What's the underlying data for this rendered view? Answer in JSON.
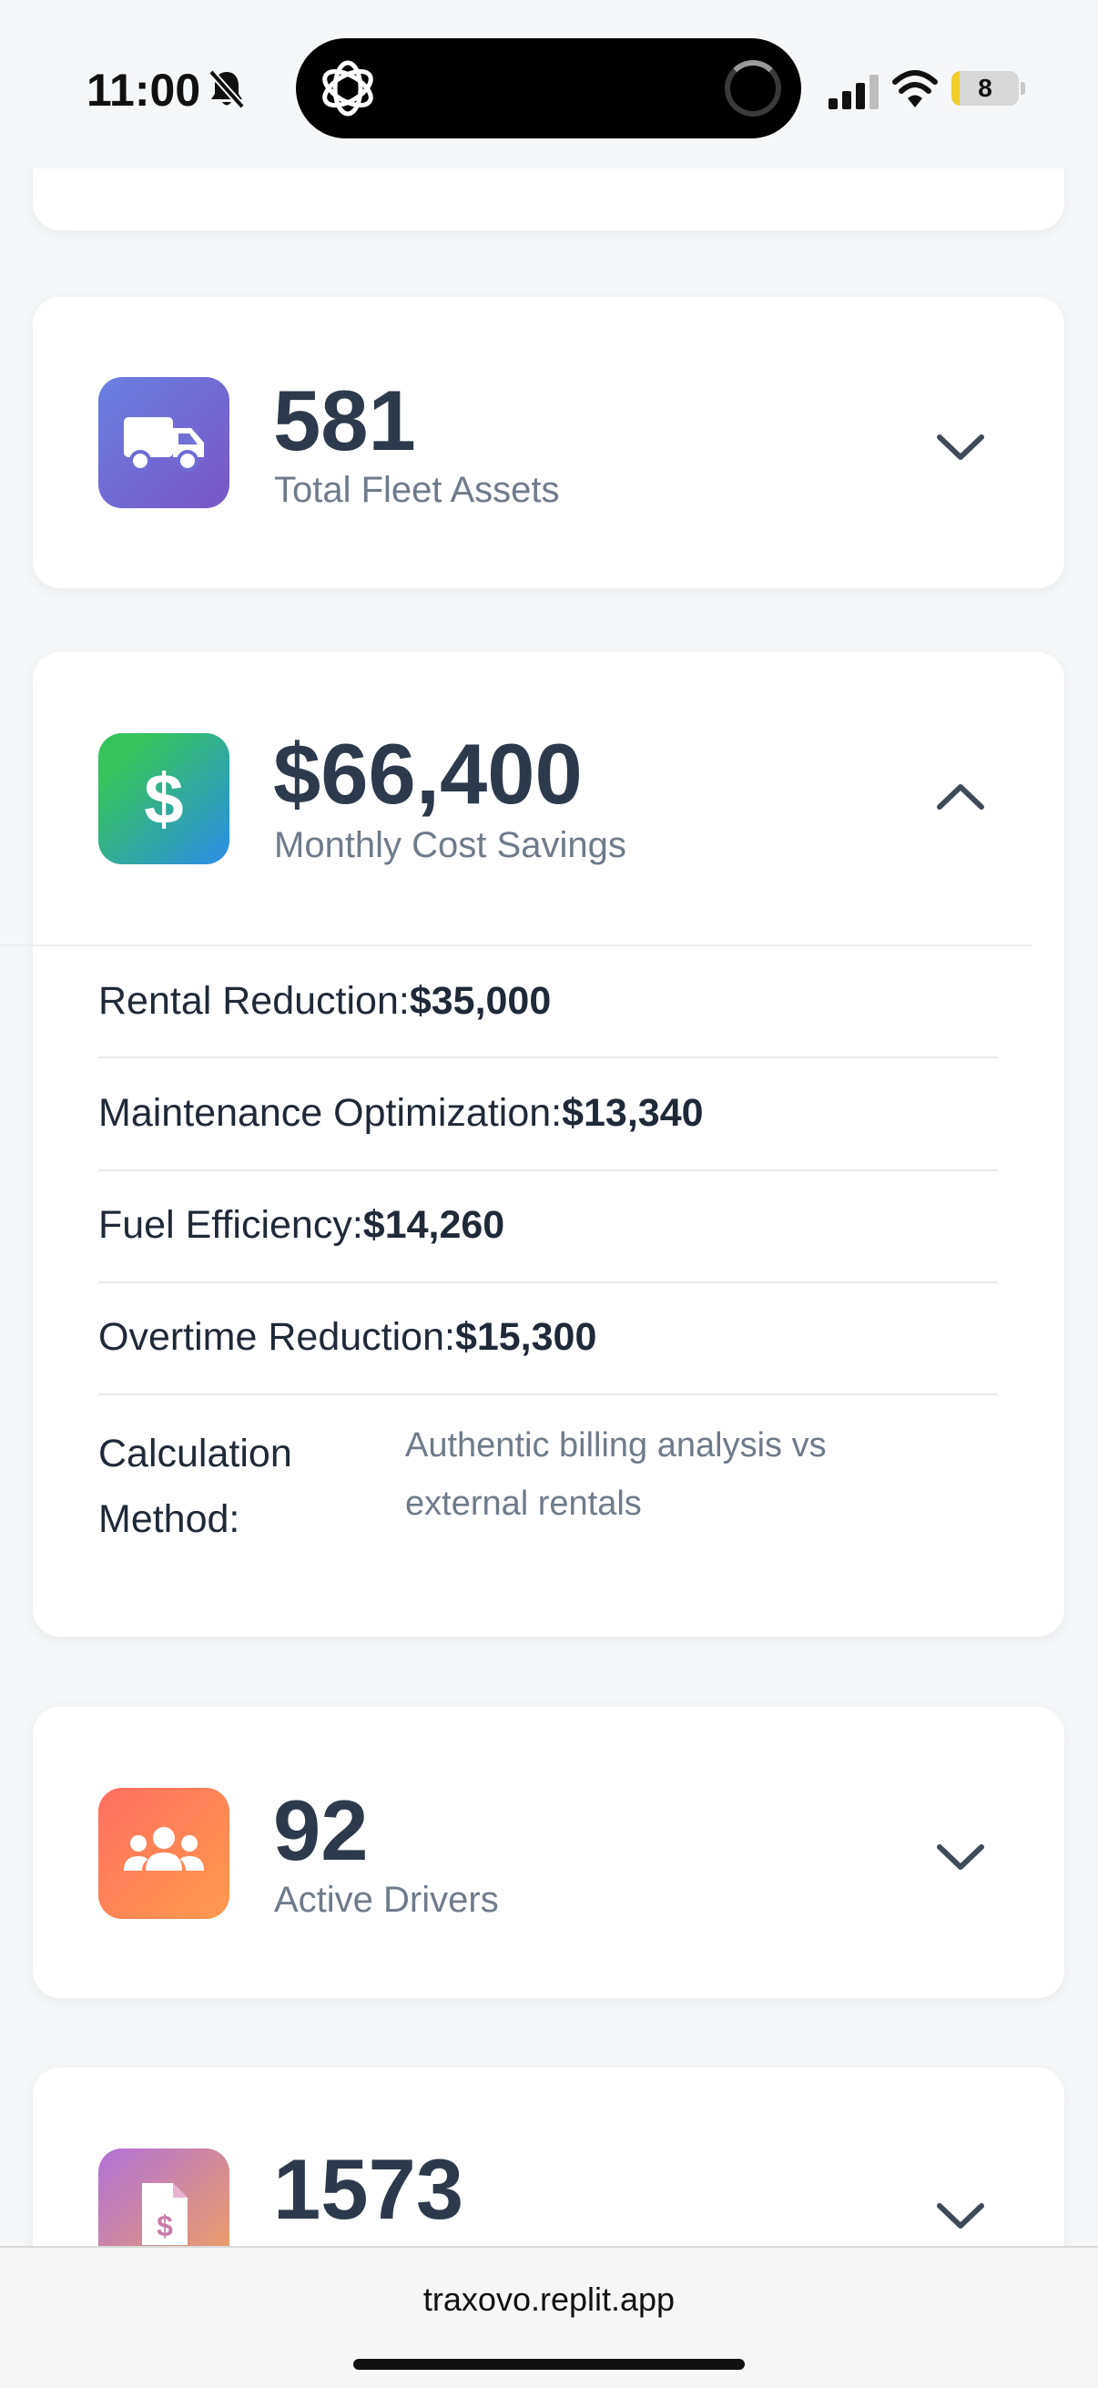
{
  "status_bar": {
    "time": "11:00",
    "battery_level": "8",
    "battery_fraction": 0.08,
    "icons": [
      "bell-slash-icon",
      "chatgpt-icon",
      "spinner-icon",
      "signal-icon",
      "wifi-icon",
      "battery-icon"
    ]
  },
  "cards": [
    {
      "value": "581",
      "label": "Total Fleet Assets",
      "icon": "truck-icon",
      "expanded": false
    },
    {
      "value": "$66,400",
      "label": "Monthly Cost Savings",
      "icon": "dollar-icon",
      "expanded": true
    },
    {
      "value": "92",
      "label": "Active Drivers",
      "icon": "users-icon",
      "expanded": false
    },
    {
      "value": "1573",
      "label": "",
      "icon": "invoice-icon",
      "expanded": false
    }
  ],
  "savings_breakdown": [
    {
      "label": "Rental Reduction:",
      "value": "$35,000"
    },
    {
      "label": "Maintenance Optimization:",
      "value": "$13,340"
    },
    {
      "label": "Fuel Efficiency:",
      "value": "$14,260"
    },
    {
      "label": "Overtime Reduction:",
      "value": "$15,300"
    }
  ],
  "calculation_method": {
    "label": "Calculation Method:",
    "value": "Authentic billing analysis vs external rentals"
  },
  "browser": {
    "url": "traxovo.replit.app"
  },
  "colors": {
    "fleet_gradient": [
      "#6a7fe3",
      "#7a56c4"
    ],
    "savings_gradient": [
      "#36c35c",
      "#2a8de8"
    ],
    "drivers_gradient": [
      "#ff6f61",
      "#ff9a4d"
    ],
    "invoice_gradient": [
      "#b071d9",
      "#f3a35a"
    ],
    "text_primary": "#2d3a4b",
    "text_secondary": "#6f7b8a"
  }
}
